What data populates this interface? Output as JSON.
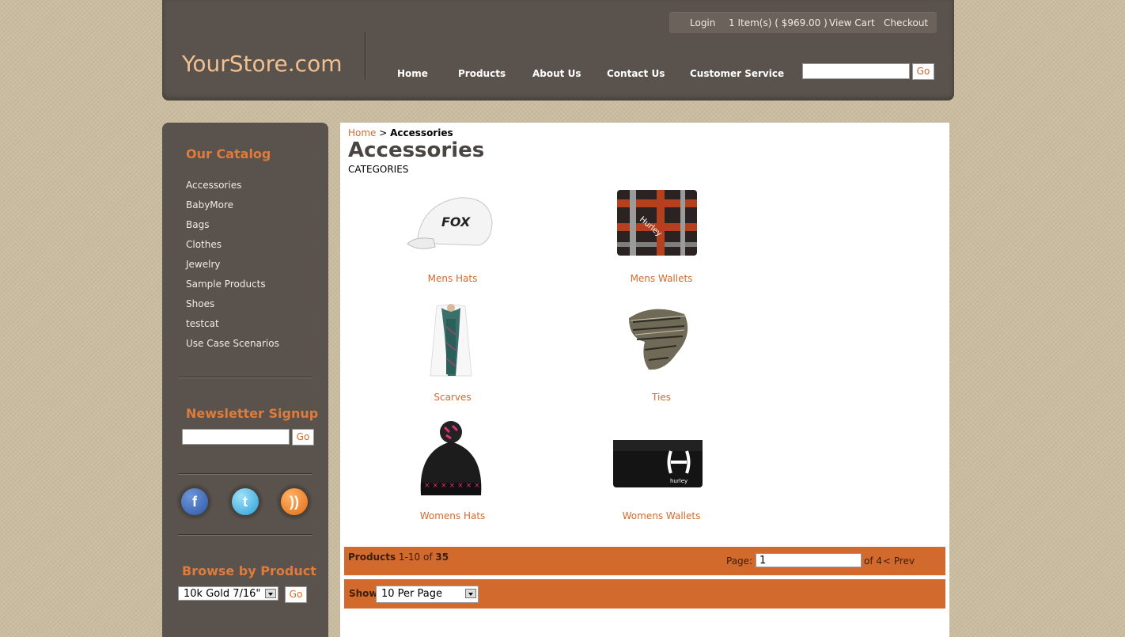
{
  "header": {
    "logo": "YourStore.com",
    "top_links": {
      "login": "Login",
      "cart_summary": "1 Item(s)  ( $969.00 )",
      "view_cart": "View Cart",
      "checkout": "Checkout"
    },
    "nav": [
      "Home",
      "Products",
      "About Us",
      "Contact Us",
      "Customer Service"
    ],
    "search": {
      "value": "",
      "go_label": "Go"
    }
  },
  "sidebar": {
    "catalog_heading": "Our Catalog",
    "categories": [
      "Accessories",
      "BabyMore",
      "Bags",
      "Clothes",
      "Jewelry",
      "Sample Products",
      "Shoes",
      "testcat",
      "Use Case Scenarios"
    ],
    "newsletter": {
      "heading": "Newsletter Signup",
      "value": "",
      "go_label": "Go"
    },
    "social": [
      "facebook-icon",
      "twitter-icon",
      "rss-icon"
    ],
    "browse": {
      "heading": "Browse by Product",
      "selected": "10k Gold 7/16\"",
      "go_label": "Go"
    }
  },
  "main": {
    "breadcrumb": {
      "home": "Home",
      "separator": " > ",
      "current": "Accessories"
    },
    "title": "Accessories",
    "categories_label": "CATEGORIES",
    "tiles": [
      {
        "label": "Mens Hats",
        "icon": "white-cap-image"
      },
      {
        "label": "Mens Wallets",
        "icon": "plaid-wallet-image"
      },
      {
        "label": "Scarves",
        "icon": "scarf-image"
      },
      {
        "label": "Ties",
        "icon": "tie-image"
      },
      {
        "label": "Womens Hats",
        "icon": "beanie-image"
      },
      {
        "label": "Womens Wallets",
        "icon": "black-wallet-image"
      }
    ],
    "pager": {
      "products_label": "Products",
      "range": "1-10",
      "of_label": "of",
      "total": "35",
      "page_label": "Page:",
      "page_value": "1",
      "of_pages": "of 4",
      "prev": "< Prev"
    },
    "show": {
      "label": "Show",
      "selected": "10 Per Page"
    }
  },
  "colors": {
    "accent": "#d26a2e",
    "header_bg": "#5a524c",
    "page_bg": "#cbbd9f"
  }
}
